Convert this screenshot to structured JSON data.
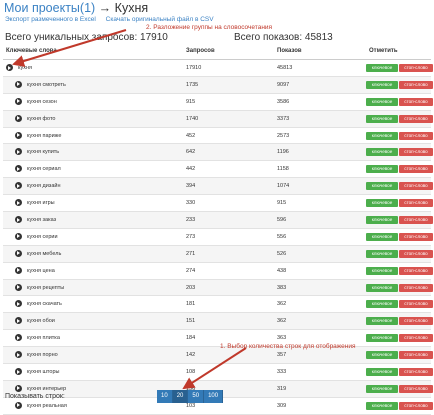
{
  "header": {
    "title_link": "Мои проекты(1)",
    "title_arrow": "→",
    "title_current": "Кухня",
    "export_link": "Экспорт размеченного в Excel",
    "download_link": "Скачать оригинальный файл в CSV"
  },
  "annotations": {
    "grouping": "2. Разложение группы на словосочетания",
    "row_count": "1. Выбор количества строк для отображения"
  },
  "stats": {
    "unique_queries": "Всего уникальных запросов: 17910",
    "total_impressions": "Всего показов: 45813"
  },
  "table": {
    "headers": [
      "Ключевые слова",
      "Запросов",
      "Показов",
      "Отметить"
    ],
    "badge_keyword": "ключевое",
    "badge_stop": "стоп-слово",
    "rows": [
      {
        "keyword": "кухня",
        "queries": "17910",
        "impressions": "45813"
      },
      {
        "keyword": "кухня смотреть",
        "queries": "1735",
        "impressions": "9097"
      },
      {
        "keyword": "кухня сезон",
        "queries": "915",
        "impressions": "3586"
      },
      {
        "keyword": "кухня фото",
        "queries": "1740",
        "impressions": "3373"
      },
      {
        "keyword": "кухня париже",
        "queries": "452",
        "impressions": "2573"
      },
      {
        "keyword": "кухня купить",
        "queries": "642",
        "impressions": "1196"
      },
      {
        "keyword": "кухня сериал",
        "queries": "442",
        "impressions": "1158"
      },
      {
        "keyword": "кухня дизайн",
        "queries": "394",
        "impressions": "1074"
      },
      {
        "keyword": "кухня игры",
        "queries": "330",
        "impressions": "915"
      },
      {
        "keyword": "кухня заказ",
        "queries": "233",
        "impressions": "596"
      },
      {
        "keyword": "кухня серии",
        "queries": "273",
        "impressions": "556"
      },
      {
        "keyword": "кухня мебель",
        "queries": "271",
        "impressions": "526"
      },
      {
        "keyword": "кухня цена",
        "queries": "274",
        "impressions": "438"
      },
      {
        "keyword": "кухня рецепты",
        "queries": "203",
        "impressions": "383"
      },
      {
        "keyword": "кухня скачать",
        "queries": "181",
        "impressions": "362"
      },
      {
        "keyword": "кухня обои",
        "queries": "151",
        "impressions": "362"
      },
      {
        "keyword": "кухня плитка",
        "queries": "184",
        "impressions": "363"
      },
      {
        "keyword": "кухня порно",
        "queries": "142",
        "impressions": "357"
      },
      {
        "keyword": "кухня шторы",
        "queries": "108",
        "impressions": "333"
      },
      {
        "keyword": "кухня интерьер",
        "queries": "156",
        "impressions": "319"
      },
      {
        "keyword": "кухня реальная",
        "queries": "103",
        "impressions": "309"
      }
    ]
  },
  "pager": {
    "label": "Показывать строк:",
    "options": [
      "10",
      "20",
      "50",
      "100"
    ],
    "selected": "20"
  },
  "colors": {
    "link": "#3b82c4",
    "annotation": "#c0392b",
    "badge_keyword": "#4cae4c",
    "badge_stop": "#d9534f",
    "pager": "#337ab7"
  }
}
